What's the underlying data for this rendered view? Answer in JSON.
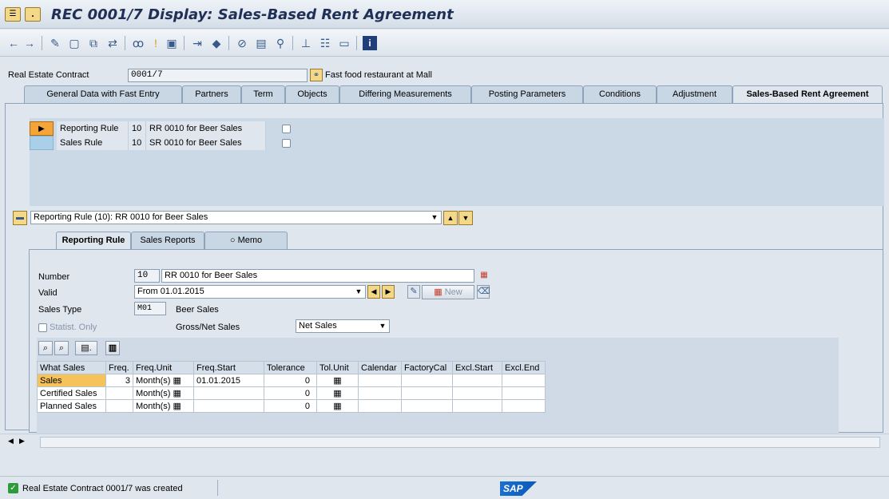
{
  "window": {
    "title": "REC 0001/7 Display: Sales-Based Rent Agreement"
  },
  "header": {
    "contract_label": "Real Estate Contract",
    "contract_value": "0001/7",
    "contract_desc": "Fast food restaurant at Mall"
  },
  "tabs": [
    {
      "label": "General Data with Fast Entry"
    },
    {
      "label": "Partners"
    },
    {
      "label": "Term"
    },
    {
      "label": "Objects"
    },
    {
      "label": "Differing Measurements"
    },
    {
      "label": "Posting Parameters"
    },
    {
      "label": "Conditions"
    },
    {
      "label": "Adjustment"
    },
    {
      "label": "Sales-Based Rent Agreement"
    }
  ],
  "rules": [
    {
      "type": "Reporting Rule",
      "num": "10",
      "desc": "RR 0010 for Beer Sales"
    },
    {
      "type": "Sales Rule",
      "num": "10",
      "desc": "SR 0010 for Beer Sales"
    }
  ],
  "dropdown": {
    "value": "Reporting Rule (10): RR 0010 for Beer Sales"
  },
  "subtabs": [
    {
      "label": "Reporting Rule"
    },
    {
      "label": "Sales Reports"
    },
    {
      "label": "Memo"
    }
  ],
  "form": {
    "number_label": "Number",
    "number_value": "10",
    "number_desc": "RR 0010 for Beer Sales",
    "valid_label": "Valid",
    "valid_value": "From 01.01.2015",
    "new_label": "New",
    "sales_type_label": "Sales Type",
    "sales_type_value": "M01",
    "sales_type_desc": "Beer Sales",
    "statist_label": "Statist. Only",
    "gross_net_label": "Gross/Net Sales",
    "gross_net_value": "Net Sales"
  },
  "table": {
    "headers": [
      "What Sales",
      "Freq.",
      "Freq.Unit",
      "Freq.Start",
      "Tolerance",
      "Tol.Unit",
      "Calendar",
      "FactoryCal",
      "Excl.Start",
      "Excl.End"
    ],
    "rows": [
      {
        "what": "Sales",
        "freq": "3",
        "unit": "Month(s)",
        "start": "01.01.2015",
        "tol": "0"
      },
      {
        "what": "Certified Sales",
        "freq": "",
        "unit": "Month(s)",
        "start": "",
        "tol": "0"
      },
      {
        "what": "Planned Sales",
        "freq": "",
        "unit": "Month(s)",
        "start": "",
        "tol": "0"
      }
    ]
  },
  "status": {
    "message": "Real Estate Contract 0001/7 was created"
  },
  "brand": {
    "logo": "SAP",
    "color": "#0a6ed1"
  }
}
